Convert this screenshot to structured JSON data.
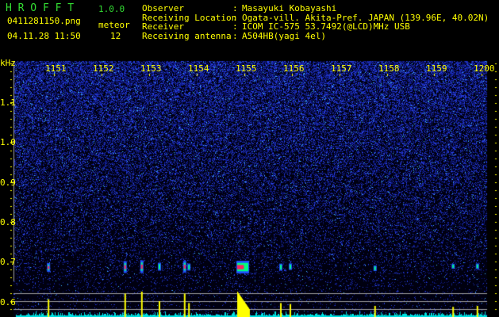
{
  "app": {
    "name": "H R O F F T",
    "version": "1.0.0"
  },
  "file": {
    "name": "0411281150.png",
    "datetime": "04.11.28 11:50"
  },
  "meteor": {
    "label": "meteor",
    "count": "12"
  },
  "info": [
    {
      "label": "Observer",
      "value": "Masayuki Kobayashi"
    },
    {
      "label": "Receiving Location",
      "value": "Ogata-vill. Akita-Pref. JAPAN (139.96E, 40.02N)"
    },
    {
      "label": "Receiver",
      "value": "ICOM IC-575 53.7492(@LCD)MHz USB"
    },
    {
      "label": "Receiving antenna",
      "value": "A504HB(yagi 4el)"
    }
  ],
  "chart_data": {
    "type": "heatmap",
    "ylabel": "kHz",
    "x_ticks": [
      "1151",
      "1152",
      "1153",
      "1154",
      "1155",
      "1156",
      "1157",
      "1158",
      "1159",
      "1200"
    ],
    "y_ticks": [
      "1.1",
      "1.0",
      "0.9",
      "0.8",
      "0.7",
      "0.6"
    ],
    "xlim": [
      "11:50",
      "12:00"
    ],
    "ylim": [
      0.57,
      1.19
    ],
    "colors": {
      "background": "#000010",
      "noise": "#1a2fd0",
      "strong": "#ff2060",
      "histogram_meteor": "#ffff00",
      "histogram_noise": "#00e0e0",
      "grid": "#a0a0a0"
    },
    "echoes": [
      {
        "time_min": 0.87,
        "freq_khz": 0.685,
        "strength": 0.6
      },
      {
        "time_min": 2.48,
        "freq_khz": 0.686,
        "strength": 0.9
      },
      {
        "time_min": 2.83,
        "freq_khz": 0.687,
        "strength": 1.0
      },
      {
        "time_min": 3.2,
        "freq_khz": 0.687,
        "strength": 0.5
      },
      {
        "time_min": 3.73,
        "freq_khz": 0.687,
        "strength": 0.9
      },
      {
        "time_min": 3.82,
        "freq_khz": 0.686,
        "strength": 0.4
      },
      {
        "time_min": 4.85,
        "freq_khz": 0.686,
        "strength": 1.0
      },
      {
        "time_min": 5.75,
        "freq_khz": 0.686,
        "strength": 0.4
      },
      {
        "time_min": 5.95,
        "freq_khz": 0.687,
        "strength": 0.35
      },
      {
        "time_min": 7.73,
        "freq_khz": 0.683,
        "strength": 0.25
      },
      {
        "time_min": 9.37,
        "freq_khz": 0.688,
        "strength": 0.2
      },
      {
        "time_min": 9.88,
        "freq_khz": 0.688,
        "strength": 0.25
      }
    ]
  }
}
